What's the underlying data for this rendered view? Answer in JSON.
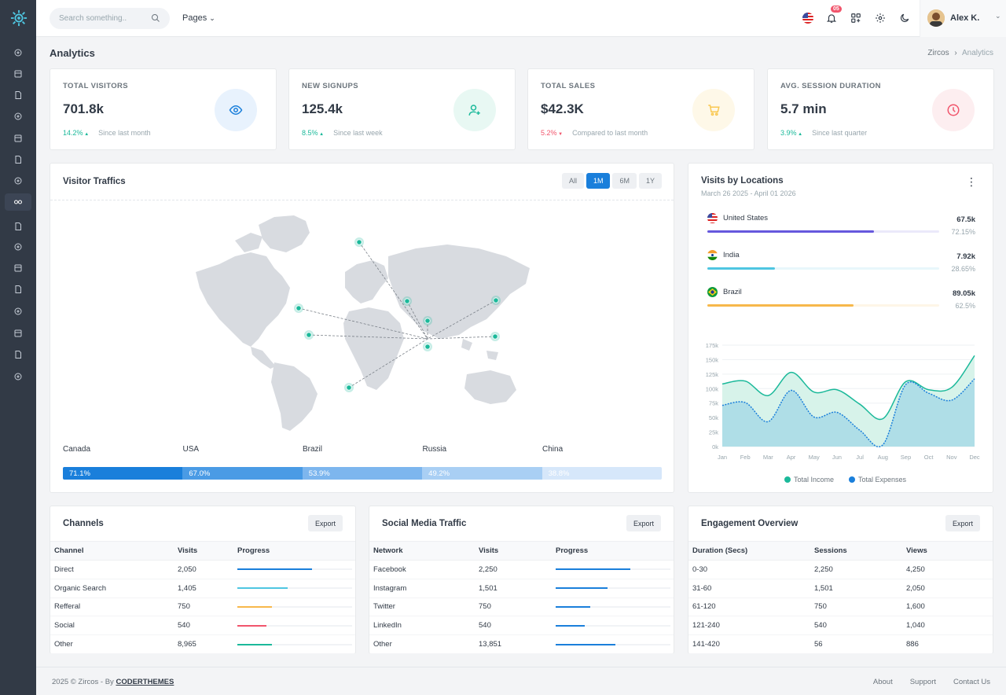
{
  "topbar": {
    "search_placeholder": "Search something..",
    "pages_label": "Pages",
    "notification_count": "05",
    "user_name": "Alex K."
  },
  "page": {
    "title": "Analytics",
    "breadcrumb": [
      "Zircos",
      "Analytics"
    ]
  },
  "stats": [
    {
      "label": "TOTAL VISITORS",
      "value": "701.8k",
      "delta": "14.2%",
      "direction": "up",
      "since": "Since last month",
      "icon": "eye-icon",
      "color": "#1a7fdb",
      "bg": "#e8f2fd"
    },
    {
      "label": "NEW SIGNUPS",
      "value": "125.4k",
      "delta": "8.5%",
      "direction": "up",
      "since": "Since last week",
      "icon": "user-plus-icon",
      "color": "#1bb99a",
      "bg": "#e8f8f3"
    },
    {
      "label": "TOTAL SALES",
      "value": "$42.3K",
      "delta": "5.2%",
      "direction": "down",
      "since": "Compared to last month",
      "icon": "cart-icon",
      "color": "#f9c851",
      "bg": "#fef8e8"
    },
    {
      "label": "AVG. SESSION DURATION",
      "value": "5.7 min",
      "delta": "3.9%",
      "direction": "up",
      "since": "Since last quarter",
      "icon": "clock-icon",
      "color": "#f1556c",
      "bg": "#fdeef0"
    }
  ],
  "visitor_traffic": {
    "title": "Visitor Traffics",
    "ranges": [
      "All",
      "1M",
      "6M",
      "1Y"
    ],
    "active_range": "1M",
    "countries": [
      {
        "name": "Canada",
        "pct": "71.1%"
      },
      {
        "name": "USA",
        "pct": "67.0%"
      },
      {
        "name": "Brazil",
        "pct": "53.9%"
      },
      {
        "name": "Russia",
        "pct": "49.2%"
      },
      {
        "name": "China",
        "pct": "38.8%"
      }
    ]
  },
  "locations": {
    "title": "Visits by Locations",
    "date_range": "March 26 2025 - April 01 2026",
    "items": [
      {
        "name": "United States",
        "value": "67.5k",
        "pct": "72.15%",
        "fraction": 0.72,
        "color": "#6658dd"
      },
      {
        "name": "India",
        "value": "7.92k",
        "pct": "28.65%",
        "fraction": 0.29,
        "color": "#4fc6e1"
      },
      {
        "name": "Brazil",
        "value": "89.05k",
        "pct": "62.5%",
        "fraction": 0.63,
        "color": "#f7b84b"
      }
    ]
  },
  "chart_data": {
    "type": "area",
    "categories": [
      "Jan",
      "Feb",
      "Mar",
      "Apr",
      "May",
      "Jun",
      "Jul",
      "Aug",
      "Sep",
      "Oct",
      "Nov",
      "Dec"
    ],
    "ylim": [
      0,
      175000
    ],
    "yticks": [
      "0k",
      "25k",
      "50k",
      "75k",
      "100k",
      "125k",
      "150k",
      "175k"
    ],
    "series": [
      {
        "name": "Total Income",
        "color": "#1bb99a",
        "values": [
          108000,
          113000,
          88000,
          128000,
          94000,
          98000,
          73000,
          48000,
          112000,
          98000,
          102000,
          157000
        ]
      },
      {
        "name": "Total Expenses",
        "color": "#1a7fdb",
        "values": [
          71000,
          76000,
          43000,
          97000,
          51000,
          59000,
          28000,
          3000,
          107000,
          92000,
          80000,
          117000
        ]
      }
    ]
  },
  "channels": {
    "title": "Channels",
    "export": "Export",
    "headers": [
      "Channel",
      "Visits",
      "Progress"
    ],
    "rows": [
      {
        "name": "Direct",
        "visits": "2,050",
        "progress": 0.65,
        "color": "#1a7fdb"
      },
      {
        "name": "Organic Search",
        "visits": "1,405",
        "progress": 0.44,
        "color": "#4fc6e1"
      },
      {
        "name": "Refferal",
        "visits": "750",
        "progress": 0.3,
        "color": "#f7b84b"
      },
      {
        "name": "Social",
        "visits": "540",
        "progress": 0.25,
        "color": "#f1556c"
      },
      {
        "name": "Other",
        "visits": "8,965",
        "progress": 0.3,
        "color": "#1bb99a"
      }
    ]
  },
  "social": {
    "title": "Social Media Traffic",
    "export": "Export",
    "headers": [
      "Network",
      "Visits",
      "Progress"
    ],
    "rows": [
      {
        "name": "Facebook",
        "visits": "2,250",
        "progress": 0.65
      },
      {
        "name": "Instagram",
        "visits": "1,501",
        "progress": 0.45
      },
      {
        "name": "Twitter",
        "visits": "750",
        "progress": 0.3
      },
      {
        "name": "LinkedIn",
        "visits": "540",
        "progress": 0.25
      },
      {
        "name": "Other",
        "visits": "13,851",
        "progress": 0.52
      }
    ]
  },
  "engagement": {
    "title": "Engagement Overview",
    "export": "Export",
    "headers": [
      "Duration (Secs)",
      "Sessions",
      "Views"
    ],
    "rows": [
      [
        "0-30",
        "2,250",
        "4,250"
      ],
      [
        "31-60",
        "1,501",
        "2,050"
      ],
      [
        "61-120",
        "750",
        "1,600"
      ],
      [
        "121-240",
        "540",
        "1,040"
      ],
      [
        "141-420",
        "56",
        "886"
      ]
    ]
  },
  "footer": {
    "copyright": "2025 © Zircos - By ",
    "brand": "CODERTHEMES",
    "links": [
      "About",
      "Support",
      "Contact Us"
    ]
  }
}
